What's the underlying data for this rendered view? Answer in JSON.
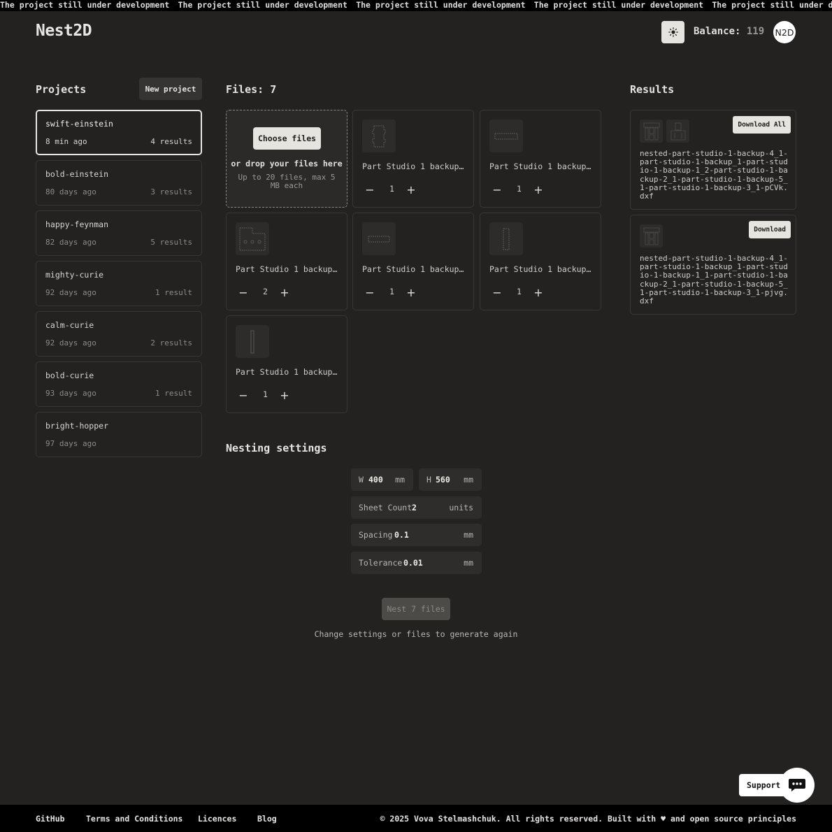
{
  "banner": {
    "text": "The project still under development"
  },
  "header": {
    "logo": "Nest2D",
    "theme_icon": "sun-icon",
    "balance_label": "Balance:",
    "balance_value": "119",
    "avatar_initials": "N2D"
  },
  "projects": {
    "title": "Projects",
    "new_button": "New project",
    "items": [
      {
        "name": "swift-einstein",
        "age": "8 min ago",
        "results": "4 results",
        "active": true
      },
      {
        "name": "bold-einstein",
        "age": "80 days ago",
        "results": "3 results"
      },
      {
        "name": "happy-feynman",
        "age": "82 days ago",
        "results": "5 results"
      },
      {
        "name": "mighty-curie",
        "age": "92 days ago",
        "results": "1 result"
      },
      {
        "name": "calm-curie",
        "age": "92 days ago",
        "results": "2 results"
      },
      {
        "name": "bold-curie",
        "age": "93 days ago",
        "results": "1 result"
      },
      {
        "name": "bright-hopper",
        "age": "97 days ago",
        "results": ""
      }
    ]
  },
  "files": {
    "title": "Files: 7",
    "choose_button": "Choose files",
    "drop_text": "or drop your files here",
    "drop_hint": "Up to 20 files, max 5 MB each",
    "items": [
      {
        "name": "Part Studio 1 backup (…",
        "qty": "1"
      },
      {
        "name": "Part Studio 1 backup.d…",
        "qty": "1"
      },
      {
        "name": "Part Studio 1 backup (…",
        "qty": "2"
      },
      {
        "name": "Part Studio 1 backup (…",
        "qty": "1"
      },
      {
        "name": "Part Studio 1 backup (…",
        "qty": "1"
      },
      {
        "name": "Part Studio 1 backup (…",
        "qty": "1"
      }
    ],
    "minus": "−",
    "plus": "+"
  },
  "results": {
    "title": "Results",
    "items": [
      {
        "button": "Download All",
        "file": "nested-part-studio-1-backup-4_1-part-studio-1-backup_1-part-studio-1-backup-1_2-part-studio-1-backup-2_1-part-studio-1-backup-5_1-part-studio-1-backup-3_1-pCVk.dxf"
      },
      {
        "button": "Download",
        "file": "nested-part-studio-1-backup-4_1-part-studio-1-backup_1-part-studio-1-backup-1_1-part-studio-1-backup-2_1-part-studio-1-backup-5_1-part-studio-1-backup-3_1-pjvg.dxf"
      }
    ]
  },
  "nesting": {
    "title": "Nesting settings",
    "width_label": "W",
    "width_value": "400",
    "width_unit": "mm",
    "height_label": "H",
    "height_value": "560",
    "height_unit": "mm",
    "sheet_label": "Sheet Count",
    "sheet_value": "2",
    "sheet_unit": "units",
    "spacing_label": "Spacing",
    "spacing_value": "0.1",
    "spacing_unit": "mm",
    "tolerance_label": "Tolerance",
    "tolerance_value": "0.01",
    "tolerance_unit": "mm",
    "nest_button": "Nest 7 files",
    "hint": "Change settings or files to generate again"
  },
  "support": {
    "label": "Support",
    "icon": "chat-icon"
  },
  "footer": {
    "links": [
      "GitHub",
      "Terms and Conditions",
      "Licences",
      "Blog"
    ],
    "copyright": "© 2025 Vova Stelmashchuk. All rights reserved. Built with ♥ and open source principles"
  }
}
